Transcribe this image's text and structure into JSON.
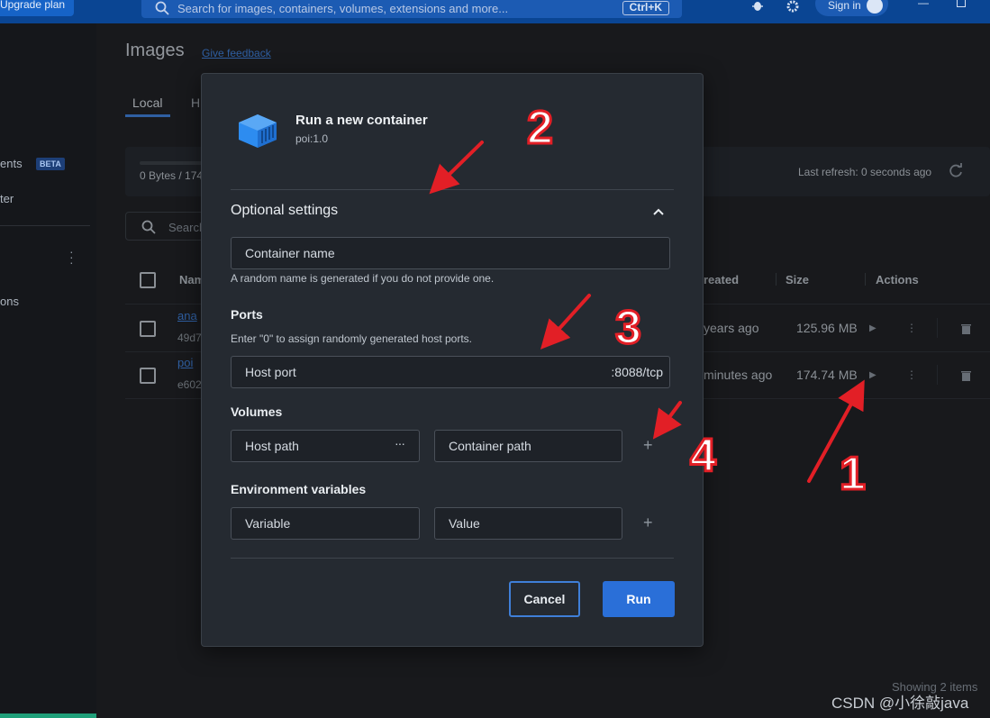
{
  "topbar": {
    "upgrade_label": "Upgrade plan",
    "search_placeholder": "Search for images, containers, volumes, extensions and more...",
    "search_shortcut": "Ctrl+K",
    "signin_label": "Sign in"
  },
  "sidebar": {
    "item_extensions_partial": "ents",
    "beta_badge": "BETA",
    "item_filter_partial": "ter",
    "item_extensions2_partial": "ons"
  },
  "page": {
    "title": "Images",
    "feedback_link": "Give feedback",
    "tabs": [
      "Local",
      "H"
    ],
    "storage_text": "0 Bytes / 174",
    "last_refresh": "Last refresh: 0 seconds ago",
    "search_placeholder": "Search",
    "columns": {
      "name": "Nam",
      "created": "reated",
      "size": "Size",
      "actions": "Actions"
    },
    "rows": [
      {
        "name": "ana",
        "id": "49d7",
        "created": "years ago",
        "size": "125.96 MB"
      },
      {
        "name": "poi",
        "id": "e602",
        "created": "minutes ago",
        "size": "174.74 MB"
      }
    ],
    "showing": "Showing 2 items"
  },
  "modal": {
    "title": "Run a new container",
    "subtitle": "poi:1.0",
    "optional_settings": "Optional settings",
    "container_name_placeholder": "Container name",
    "container_name_help": "A random name is generated if you do not provide one.",
    "ports_label": "Ports",
    "ports_help": "Enter \"0\" to assign randomly generated host ports.",
    "host_port_placeholder": "Host port",
    "host_port_suffix": ":8088/tcp",
    "volumes_label": "Volumes",
    "host_path_placeholder": "Host path",
    "host_path_more": "···",
    "container_path_placeholder": "Container path",
    "env_label": "Environment variables",
    "variable_placeholder": "Variable",
    "value_placeholder": "Value",
    "cancel_label": "Cancel",
    "run_label": "Run"
  },
  "annotations": {
    "numbers": [
      "1",
      "2",
      "3",
      "4"
    ],
    "color": "#e21f26"
  },
  "watermark": "CSDN @小徐敲java"
}
